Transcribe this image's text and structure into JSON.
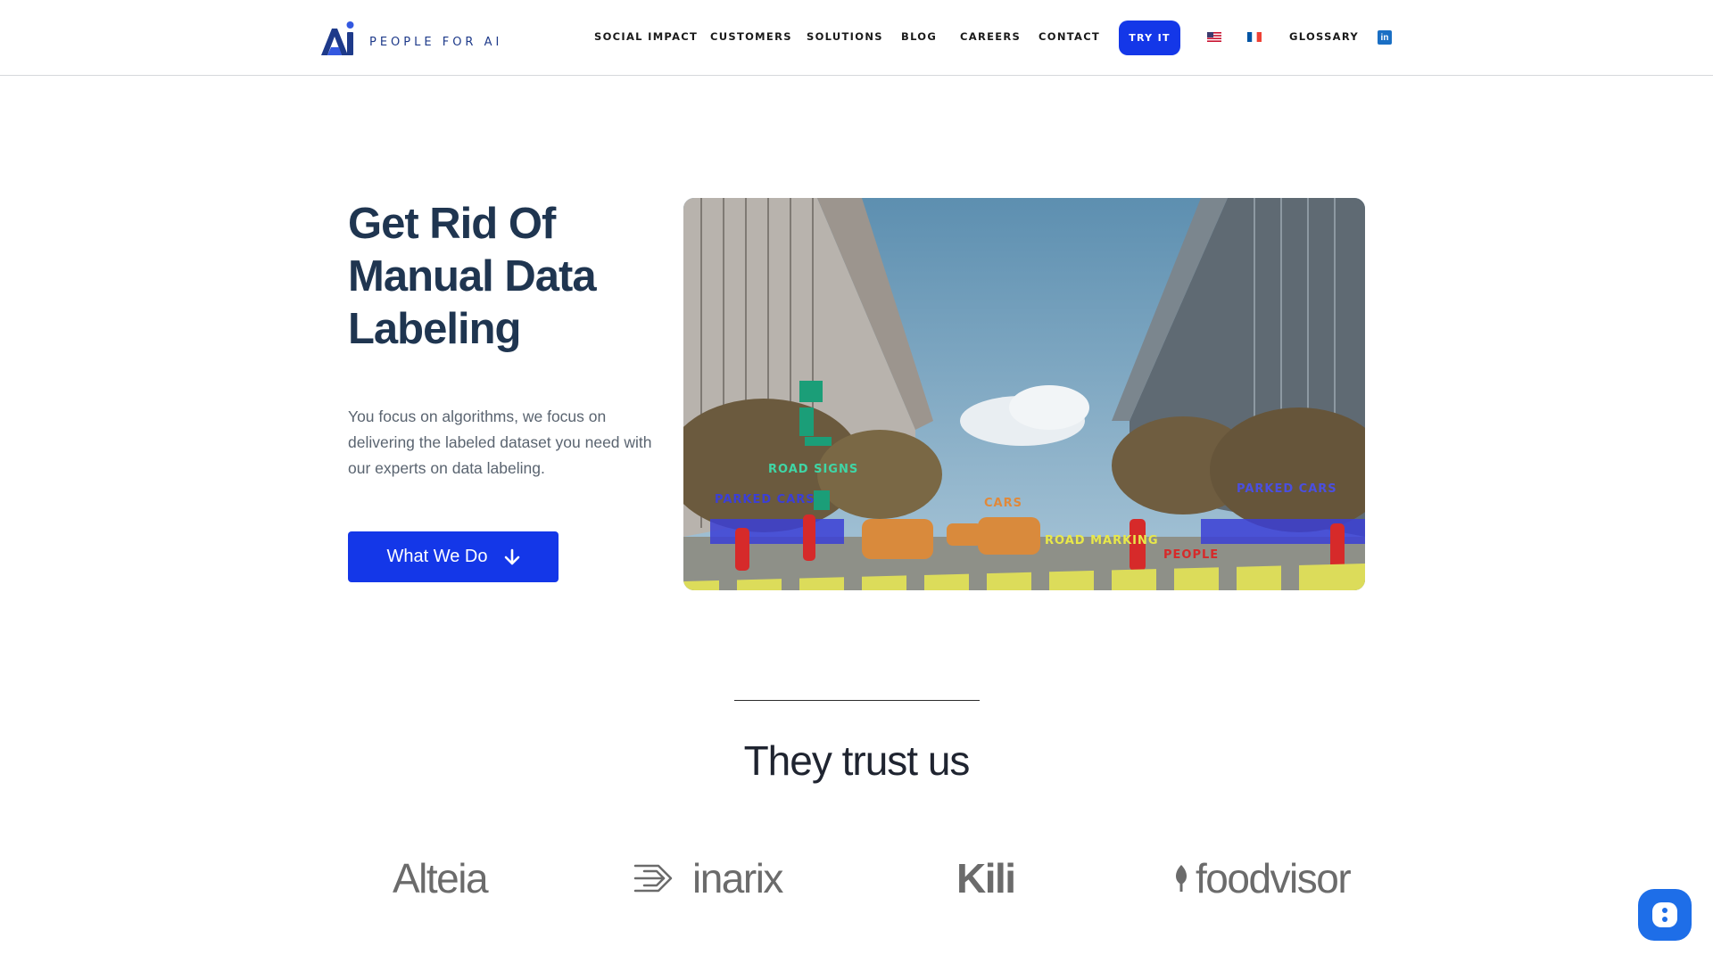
{
  "header": {
    "logo_text": "PEOPLE FOR AI",
    "nav": [
      {
        "label": "SOCIAL IMPACT"
      },
      {
        "label": "CUSTOMERS"
      },
      {
        "label": "SOLUTIONS"
      },
      {
        "label": "BLOG"
      },
      {
        "label": "CAREERS"
      },
      {
        "label": "CONTACT"
      }
    ],
    "try_label": "TRY IT",
    "glossary_label": "GLOSSARY",
    "linkedin_icon": "linkedin-icon",
    "flags": [
      "us-flag-icon",
      "fr-flag-icon"
    ]
  },
  "hero": {
    "title": "Get Rid Of Manual Data Labeling",
    "description": "You focus on algorithms, we focus on delivering the labeled dataset you need with our experts on data labeling.",
    "cta_label": "What We Do",
    "cta_icon": "arrow-down-icon",
    "image_labels": {
      "road_signs": "ROAD SIGNS",
      "parked_cars_left": "PARKED CARS",
      "parked_cars_right": "PARKED CARS",
      "cars": "CARS",
      "road_marking": "ROAD MARKING",
      "people": "PEOPLE"
    }
  },
  "trust": {
    "title": "They trust us",
    "clients": [
      {
        "name": "Alteia"
      },
      {
        "name": "inarix"
      },
      {
        "name": "Kili"
      },
      {
        "name": "foodvisor"
      }
    ]
  },
  "colors": {
    "accent": "#1437e8",
    "title": "#1f3550",
    "chat": "#1e6ee8"
  }
}
